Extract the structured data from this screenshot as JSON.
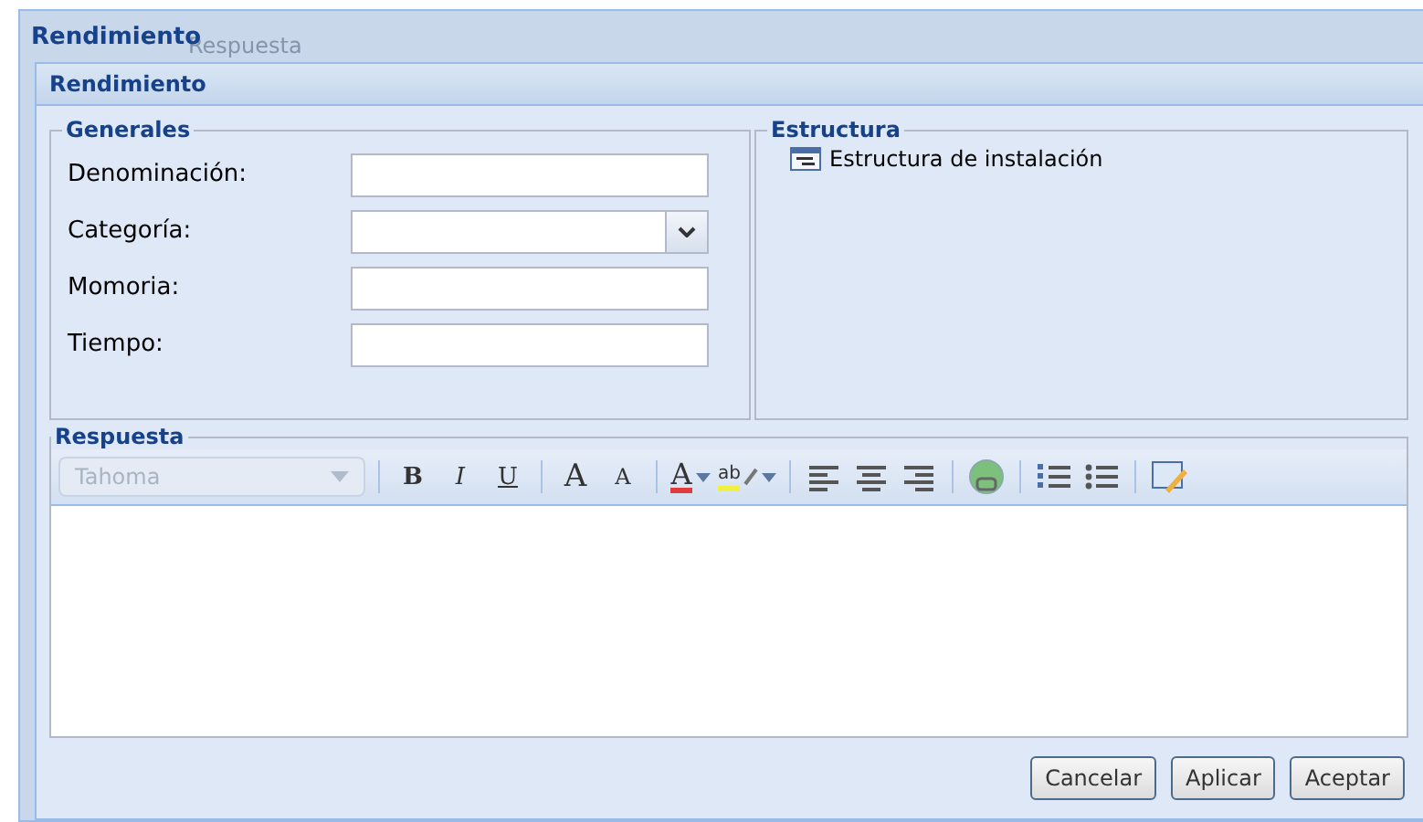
{
  "window": {
    "title": "Rendimiento",
    "background_tab": "Respuesta"
  },
  "panel": {
    "title": "Rendimiento"
  },
  "generales": {
    "legend": "Generales",
    "fields": [
      {
        "label": "Denominación:",
        "kind": "text"
      },
      {
        "label": "Categoría:",
        "kind": "combo"
      },
      {
        "label": "Momoria:",
        "kind": "text"
      },
      {
        "label": "Tiempo:",
        "kind": "text"
      }
    ]
  },
  "estructura": {
    "legend": "Estructura",
    "items": [
      {
        "label": "Estructura de instalación",
        "selected": false
      }
    ]
  },
  "respuesta": {
    "legend": "Respuesta",
    "font": {
      "value": "Tahoma",
      "disabled": true
    },
    "toolbar": [
      {
        "kind": "sep"
      },
      {
        "kind": "bold",
        "label": "B"
      },
      {
        "kind": "italic",
        "label": "I"
      },
      {
        "kind": "underline",
        "label": "U"
      },
      {
        "kind": "sep"
      },
      {
        "kind": "grow",
        "label": "A"
      },
      {
        "kind": "shrink",
        "label": "A"
      },
      {
        "kind": "sep"
      },
      {
        "kind": "forecolor",
        "label": "A",
        "color": "#e03c3c"
      },
      {
        "kind": "highlight",
        "label": "ab",
        "color": "#f0f040"
      },
      {
        "kind": "sep"
      },
      {
        "kind": "align-left"
      },
      {
        "kind": "align-center"
      },
      {
        "kind": "align-right"
      },
      {
        "kind": "sep"
      },
      {
        "kind": "link"
      },
      {
        "kind": "sep"
      },
      {
        "kind": "ordered-list"
      },
      {
        "kind": "bullet-list"
      },
      {
        "kind": "sep"
      },
      {
        "kind": "source"
      }
    ]
  },
  "buttons": [
    {
      "label": "Cancelar"
    },
    {
      "label": "Aplicar"
    },
    {
      "label": "Aceptar"
    }
  ]
}
